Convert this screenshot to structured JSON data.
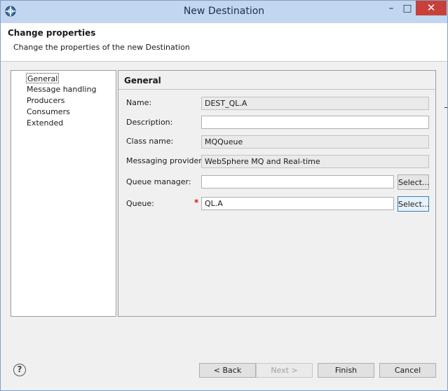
{
  "window": {
    "title": "New Destination"
  },
  "title_bar": {
    "minimize_glyph": "–",
    "maximize_glyph": "□",
    "close_glyph": "✕"
  },
  "header": {
    "title": "Change properties",
    "description": "Change the properties of the new Destination"
  },
  "tree": {
    "items": [
      {
        "label": "General",
        "selected": true
      },
      {
        "label": "Message handling"
      },
      {
        "label": "Producers"
      },
      {
        "label": "Consumers"
      },
      {
        "label": "Extended"
      }
    ]
  },
  "general": {
    "section_title": "General",
    "name": {
      "label": "Name:",
      "value": "DEST_QL.A"
    },
    "description": {
      "label": "Description:",
      "value": ""
    },
    "class_name": {
      "label": "Class name:",
      "value": "MQQueue"
    },
    "messaging_provider": {
      "label": "Messaging provider:",
      "value": "WebSphere MQ and Real-time"
    },
    "queue_manager": {
      "label": "Queue manager:",
      "value": "",
      "select_label": "Select..."
    },
    "queue": {
      "label": "Queue:",
      "required_marker": "*",
      "value": "QL.A",
      "select_label": "Select..."
    }
  },
  "footer": {
    "help_glyph": "?",
    "back_label": "< Back",
    "next_label": "Next >",
    "finish_label": "Finish",
    "cancel_label": "Cancel"
  },
  "icons": {
    "app": "app-globe-icon",
    "help": "help-icon",
    "minimize": "minimize-icon",
    "maximize": "maximize-icon",
    "close": "close-icon"
  },
  "colors": {
    "titlebar": "#c2d6ef",
    "close_button": "#c7413a",
    "required": "#dd1111"
  }
}
